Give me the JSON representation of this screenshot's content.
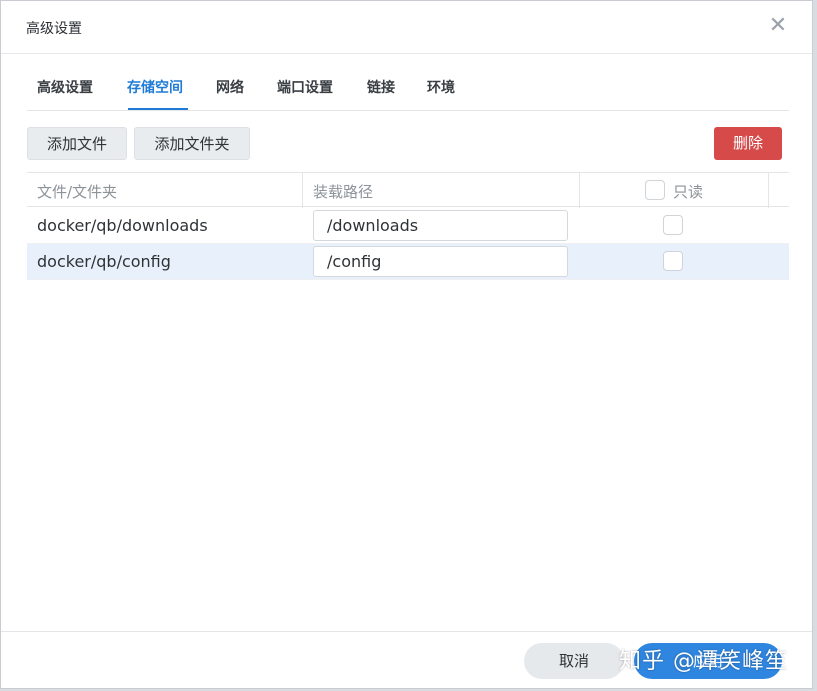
{
  "dialog": {
    "title": "高级设置"
  },
  "tabs": [
    {
      "label": "高级设置"
    },
    {
      "label": "存储空间",
      "active": true
    },
    {
      "label": "网络"
    },
    {
      "label": "端口设置"
    },
    {
      "label": "链接"
    },
    {
      "label": "环境"
    }
  ],
  "toolbar": {
    "add_file": "添加文件",
    "add_folder": "添加文件夹",
    "delete": "删除"
  },
  "table": {
    "columns": [
      "文件/文件夹",
      "装载路径",
      "只读"
    ],
    "rows": [
      {
        "file": "docker/qb/downloads",
        "mount": "/downloads",
        "readonly": false
      },
      {
        "file": "docker/qb/config",
        "mount": "/config",
        "readonly": false,
        "selected": true
      }
    ]
  },
  "footer": {
    "cancel": "取消",
    "apply": "应用"
  },
  "watermark": "知乎 @谭笑峰笙",
  "colors": {
    "accent": "#1f7bd6",
    "danger": "#d64a4a",
    "primary_button": "#2f86e0",
    "selected_row": "#e8f1fb"
  }
}
